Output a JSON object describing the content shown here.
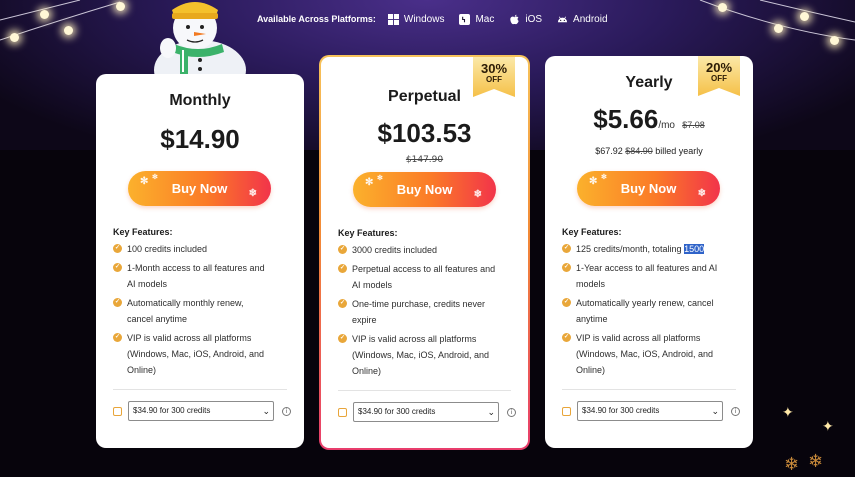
{
  "header": {
    "availability_label": "Available Across Platforms:",
    "platforms": [
      {
        "name": "Windows",
        "icon": "windows-icon"
      },
      {
        "name": "Mac",
        "icon": "mac-icon"
      },
      {
        "name": "iOS",
        "icon": "apple-icon"
      },
      {
        "name": "Android",
        "icon": "android-icon"
      }
    ]
  },
  "plans": {
    "monthly": {
      "title": "Monthly",
      "price": "$14.90",
      "buy_label": "Buy Now",
      "features_title": "Key Features:",
      "features": [
        "100 credits included",
        "1-Month access to all features and",
        "AI models",
        "Automatically monthly renew,",
        "cancel anytime",
        "VIP is valid across all platforms",
        "(Windows, Mac, iOS, Android, and",
        "Online)"
      ],
      "addon_select": "$34.90 for 300 credits"
    },
    "perpetual": {
      "title": "Perpetual",
      "price": "$103.53",
      "original_price": "$147.90",
      "badge_pct": "30%",
      "badge_off": "OFF",
      "buy_label": "Buy Now",
      "features_title": "Key Features:",
      "features": [
        "3000 credits included",
        "Perpetual access to all features and",
        "AI models",
        "One-time purchase, credits never",
        "expire",
        "VIP is valid across all platforms",
        "(Windows, Mac, iOS, Android, and",
        "Online)"
      ],
      "addon_select": "$34.90 for 300 credits"
    },
    "yearly": {
      "title": "Yearly",
      "price": "$5.66",
      "per_unit": "/mo",
      "original_price": "$7.08",
      "billed_price": "$67.92",
      "billed_original": "$84.90",
      "billed_suffix": "billed yearly",
      "badge_pct": "20%",
      "badge_off": "OFF",
      "buy_label": "Buy Now",
      "features_title": "Key Features:",
      "features": [
        "125 credits/month, totaling",
        "1500",
        "1-Year access to all features and AI",
        "models",
        "Automatically yearly renew, cancel",
        "anytime",
        "VIP is valid across all platforms",
        "(Windows, Mac, iOS, Android, and",
        "Online)"
      ],
      "addon_select": "$34.90 for 300 credits"
    }
  },
  "colors": {
    "accent_orange": "#f5a73a",
    "button_start": "#fbb12c",
    "button_end": "#f2344a",
    "highlight_blue": "#2f63c9"
  }
}
